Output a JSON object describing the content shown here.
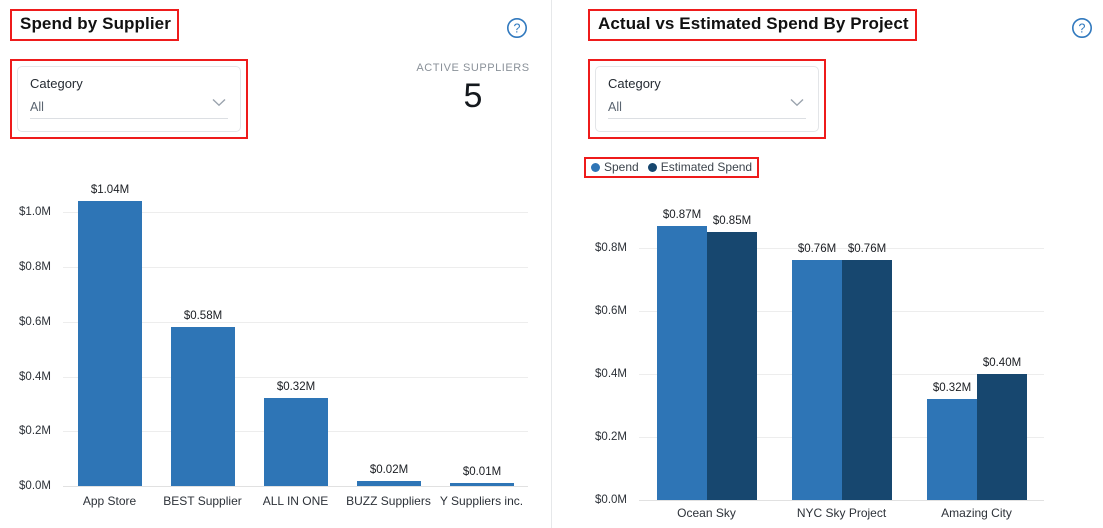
{
  "left_panel": {
    "title": "Spend by Supplier",
    "help_icon": "question-circle-icon",
    "filter": {
      "label": "Category",
      "value": "All",
      "chevron_icon": "chevron-down-icon"
    },
    "kpi": {
      "label": "ACTIVE SUPPLIERS",
      "value": "5"
    }
  },
  "right_panel": {
    "title": "Actual vs Estimated Spend By Project",
    "help_icon": "question-circle-icon",
    "filter": {
      "label": "Category",
      "value": "All",
      "chevron_icon": "chevron-down-icon"
    },
    "legend": [
      {
        "label": "Spend",
        "color": "#2e75b6"
      },
      {
        "label": "Estimated Spend",
        "color": "#17476f"
      }
    ]
  },
  "colors": {
    "spend": "#2e75b6",
    "estimated_spend": "#17476f",
    "annotation": "#ee1b1b",
    "gridline": "#ededed"
  },
  "chart_data": [
    {
      "type": "bar",
      "title": "Spend by Supplier",
      "xlabel": "",
      "ylabel": "",
      "ylim": [
        0,
        1.1
      ],
      "grid": true,
      "legend_position": "none",
      "ytick_labels": [
        "$0.0M",
        "$0.2M",
        "$0.4M",
        "$0.6M",
        "$0.8M",
        "$1.0M"
      ],
      "ytick_values": [
        0,
        0.2,
        0.4,
        0.6,
        0.8,
        1.0
      ],
      "categories": [
        "App Store",
        "BEST Supplier",
        "ALL IN ONE",
        "BUZZ Suppliers",
        "Y Suppliers inc."
      ],
      "values": [
        1.04,
        0.58,
        0.32,
        0.02,
        0.01
      ],
      "data_labels": [
        "$1.04M",
        "$0.58M",
        "$0.32M",
        "$0.02M",
        "$0.01M"
      ],
      "series_color": "#2e75b6"
    },
    {
      "type": "bar",
      "title": "Actual vs Estimated Spend By Project",
      "xlabel": "",
      "ylabel": "",
      "ylim": [
        0,
        0.92
      ],
      "grid": true,
      "legend_position": "top-left",
      "ytick_labels": [
        "$0.0M",
        "$0.2M",
        "$0.4M",
        "$0.6M",
        "$0.8M"
      ],
      "ytick_values": [
        0,
        0.2,
        0.4,
        0.6,
        0.8
      ],
      "categories": [
        "Ocean Sky",
        "NYC Sky Project",
        "Amazing City"
      ],
      "series": [
        {
          "name": "Spend",
          "color": "#2e75b6",
          "values": [
            0.87,
            0.76,
            0.32
          ],
          "data_labels": [
            "$0.87M",
            "$0.76M",
            "$0.32M"
          ]
        },
        {
          "name": "Estimated Spend",
          "color": "#17476f",
          "values": [
            0.85,
            0.76,
            0.4
          ],
          "data_labels": [
            "$0.85M",
            "$0.76M",
            "$0.40M"
          ]
        }
      ]
    }
  ]
}
